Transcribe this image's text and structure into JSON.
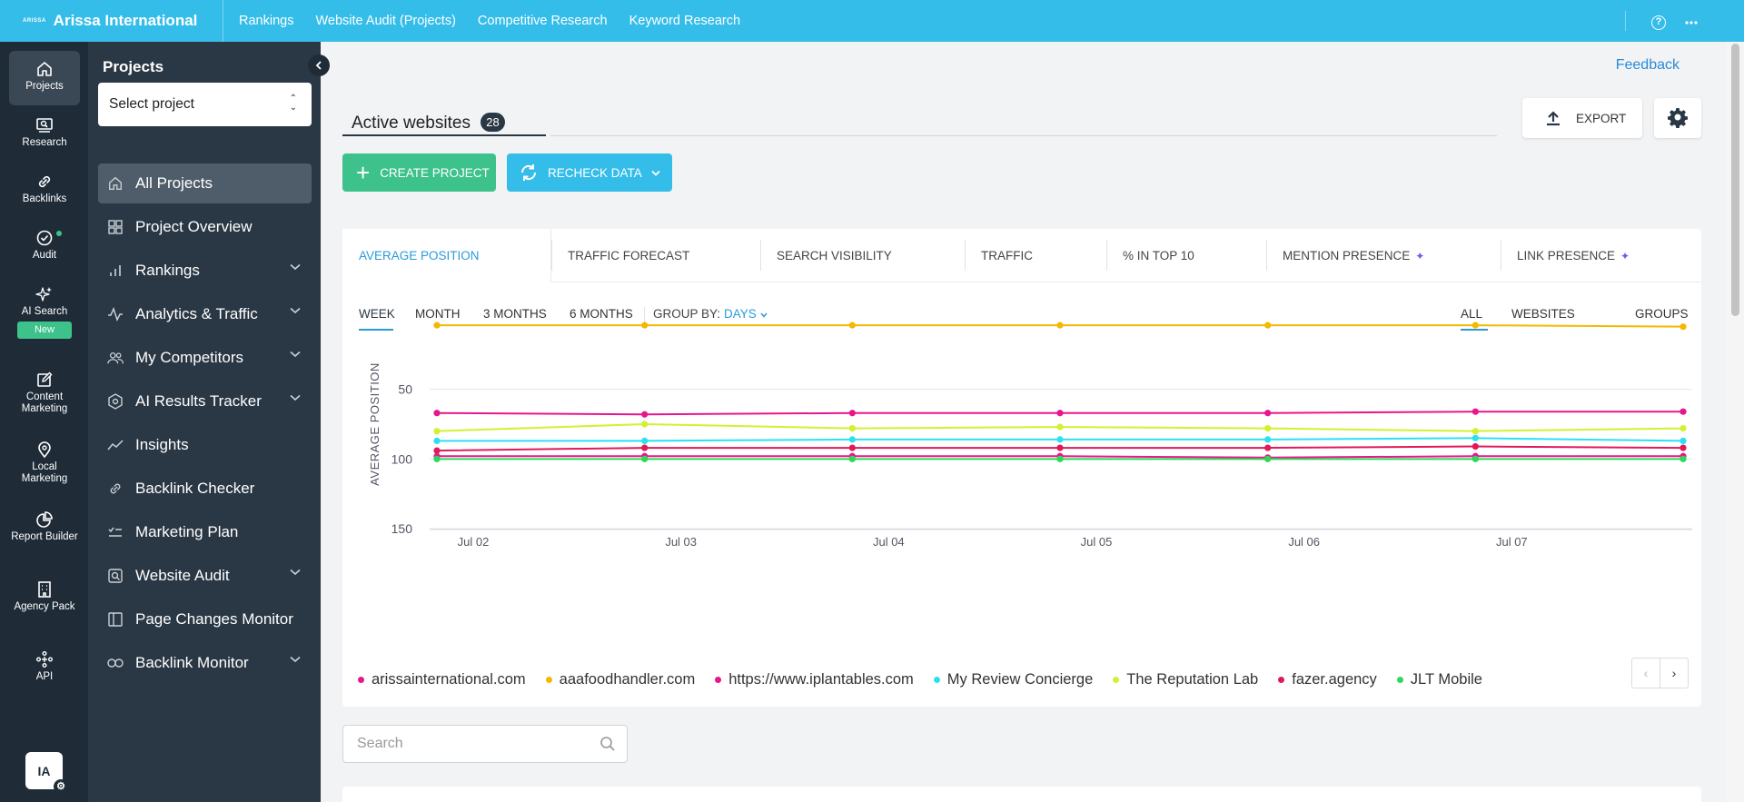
{
  "topbar": {
    "logo_text": "ARISSA",
    "brand": "Arissa International",
    "nav": [
      "Rankings",
      "Website Audit (Projects)",
      "Competitive Research",
      "Keyword Research"
    ],
    "icons": [
      "help-icon",
      "more-icon"
    ]
  },
  "rail": {
    "items": [
      {
        "label": "Projects",
        "icon": "home-icon"
      },
      {
        "label": "Research",
        "icon": "research-icon"
      },
      {
        "label": "Backlinks",
        "icon": "link-icon"
      },
      {
        "label": "Audit",
        "icon": "check-circle-icon"
      },
      {
        "label": "AI Search",
        "icon": "sparkle-icon"
      },
      {
        "label": "Content Marketing",
        "icon": "edit-icon"
      },
      {
        "label": "Local Marketing",
        "icon": "pin-icon"
      },
      {
        "label": "Report Builder",
        "icon": "pie-icon"
      },
      {
        "label": "Agency Pack",
        "icon": "building-icon"
      },
      {
        "label": "API",
        "icon": "api-icon"
      }
    ],
    "new_badge": "New",
    "avatar": "IA"
  },
  "panel": {
    "title": "Projects",
    "select_project": "Select project",
    "menu": [
      {
        "label": "All Projects",
        "active": true,
        "chevron": false
      },
      {
        "label": "Project Overview",
        "active": false,
        "chevron": false
      },
      {
        "label": "Rankings",
        "active": false,
        "chevron": true
      },
      {
        "label": "Analytics & Traffic",
        "active": false,
        "chevron": true
      },
      {
        "label": "My Competitors",
        "active": false,
        "chevron": true
      },
      {
        "label": "AI Results Tracker",
        "active": false,
        "chevron": true
      },
      {
        "label": "Insights",
        "active": false,
        "chevron": false
      },
      {
        "label": "Backlink Checker",
        "active": false,
        "chevron": false
      },
      {
        "label": "Marketing Plan",
        "active": false,
        "chevron": false
      },
      {
        "label": "Website Audit",
        "active": false,
        "chevron": true
      },
      {
        "label": "Page Changes Monitor",
        "active": false,
        "chevron": false
      },
      {
        "label": "Backlink Monitor",
        "active": false,
        "chevron": true
      }
    ]
  },
  "main": {
    "feedback": "Feedback",
    "tab_label": "Active websites",
    "tab_count": "28",
    "export": "EXPORT",
    "create_project": "CREATE PROJECT",
    "recheck_data": "RECHECK DATA",
    "search_placeholder": "Search"
  },
  "metric_tabs": [
    "AVERAGE POSITION",
    "TRAFFIC FORECAST",
    "SEARCH VISIBILITY",
    "TRAFFIC",
    "% IN TOP 10",
    "MENTION PRESENCE",
    "LINK PRESENCE"
  ],
  "periods": [
    "WEEK",
    "MONTH",
    "3 MONTHS",
    "6 MONTHS"
  ],
  "group_by": {
    "label": "GROUP BY:",
    "value": "DAYS"
  },
  "views": [
    "ALL",
    "WEBSITES",
    "GROUPS"
  ],
  "colors": {
    "accent": "#35bdea",
    "green": "#3ec28b",
    "dark": "#1f2c38",
    "link": "#2a9bd8"
  },
  "chart_data": {
    "type": "line",
    "ylabel": "AVERAGE POSITION",
    "xlabel": "",
    "y_inverted": true,
    "ylim": [
      0,
      150
    ],
    "yticks": [
      "50",
      "100",
      "150"
    ],
    "x": [
      "Jul 02",
      "Jul 03",
      "Jul 04",
      "Jul 05",
      "Jul 06",
      "Jul 07",
      ""
    ],
    "xtick_labels": [
      "Jul 02",
      "Jul 03",
      "Jul 04",
      "Jul 05",
      "Jul 06",
      "Jul 07"
    ],
    "series": [
      {
        "name": "aaafoodhandler.com",
        "color": "#f5b800",
        "values": [
          4,
          4,
          4,
          4,
          4,
          4,
          5
        ]
      },
      {
        "name": "https://www.iplantables.com",
        "color": "#e8168c",
        "values": [
          67,
          68,
          67,
          67,
          67,
          66,
          66
        ]
      },
      {
        "name": "The Reputation Lab",
        "color": "#d4f030",
        "values": [
          80,
          75,
          78,
          77,
          78,
          80,
          78
        ]
      },
      {
        "name": "My Review Concierge",
        "color": "#2de0f0",
        "values": [
          87,
          87,
          86,
          86,
          86,
          85,
          87
        ]
      },
      {
        "name": "fazer.agency",
        "color": "#e01a5a",
        "values": [
          94,
          92,
          92,
          92,
          92,
          91,
          92
        ]
      },
      {
        "name": "arissainternational.com",
        "color": "#e8168c",
        "values": [
          98,
          98,
          98,
          98,
          99,
          98,
          98
        ]
      },
      {
        "name": "JLT Mobile",
        "color": "#2ed85a",
        "values": [
          100,
          100,
          100,
          100,
          100,
          100,
          100
        ]
      }
    ],
    "legend": [
      {
        "name": "arissainternational.com",
        "color": "#e8168c"
      },
      {
        "name": "aaafoodhandler.com",
        "color": "#f5b800"
      },
      {
        "name": "https://www.iplantables.com",
        "color": "#e8168c"
      },
      {
        "name": "My Review Concierge",
        "color": "#2de0f0"
      },
      {
        "name": "The Reputation Lab",
        "color": "#d4f030"
      },
      {
        "name": "fazer.agency",
        "color": "#e01a5a"
      },
      {
        "name": "JLT Mobile",
        "color": "#2ed85a"
      }
    ],
    "grid": true
  }
}
